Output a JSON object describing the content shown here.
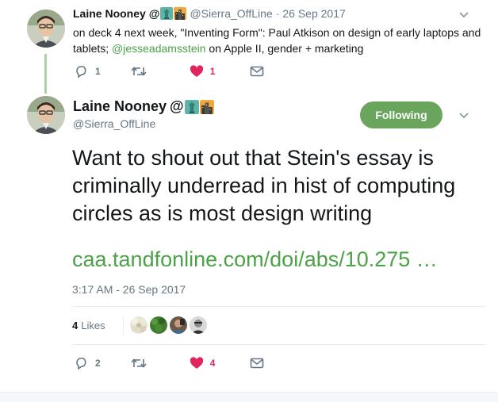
{
  "parent_tweet": {
    "name": "Laine Nooney",
    "name_suffix": "@",
    "handle": "@Sierra_OffLine",
    "separator": "·",
    "date": "26 Sep 2017",
    "text_part1": "on deck 4 next week, \"Inventing Form\": Paul Atkison on design of early laptops and tablets; ",
    "mention": "@jesseadamsstein",
    "text_part2": " on Apple II, gender + marketing",
    "reply_count": "1",
    "like_count": "1",
    "emojis": [
      "statue-of-liberty-icon",
      "cityscape-icon"
    ]
  },
  "main_tweet": {
    "name": "Laine Nooney",
    "name_suffix": "@",
    "handle": "@Sierra_OffLine",
    "follow_label": "Following",
    "text": "Want to shout out that Stein's essay is criminally underread in hist of computing circles as is most design writing",
    "link": "caa.tandfonline.com/doi/abs/10.275 …",
    "timestamp": "3:17 AM - 26 Sep 2017",
    "likes_count": "4",
    "likes_label": "Likes",
    "reply_count": "2",
    "like_count": "4",
    "emojis": [
      "statue-of-liberty-icon",
      "cityscape-icon"
    ]
  },
  "colors": {
    "accent_green": "#4ba247",
    "follow_button": "#6aa55d",
    "heart_red": "#e0245e",
    "muted_text": "#657786",
    "thread_line": "#a6d5a0"
  }
}
